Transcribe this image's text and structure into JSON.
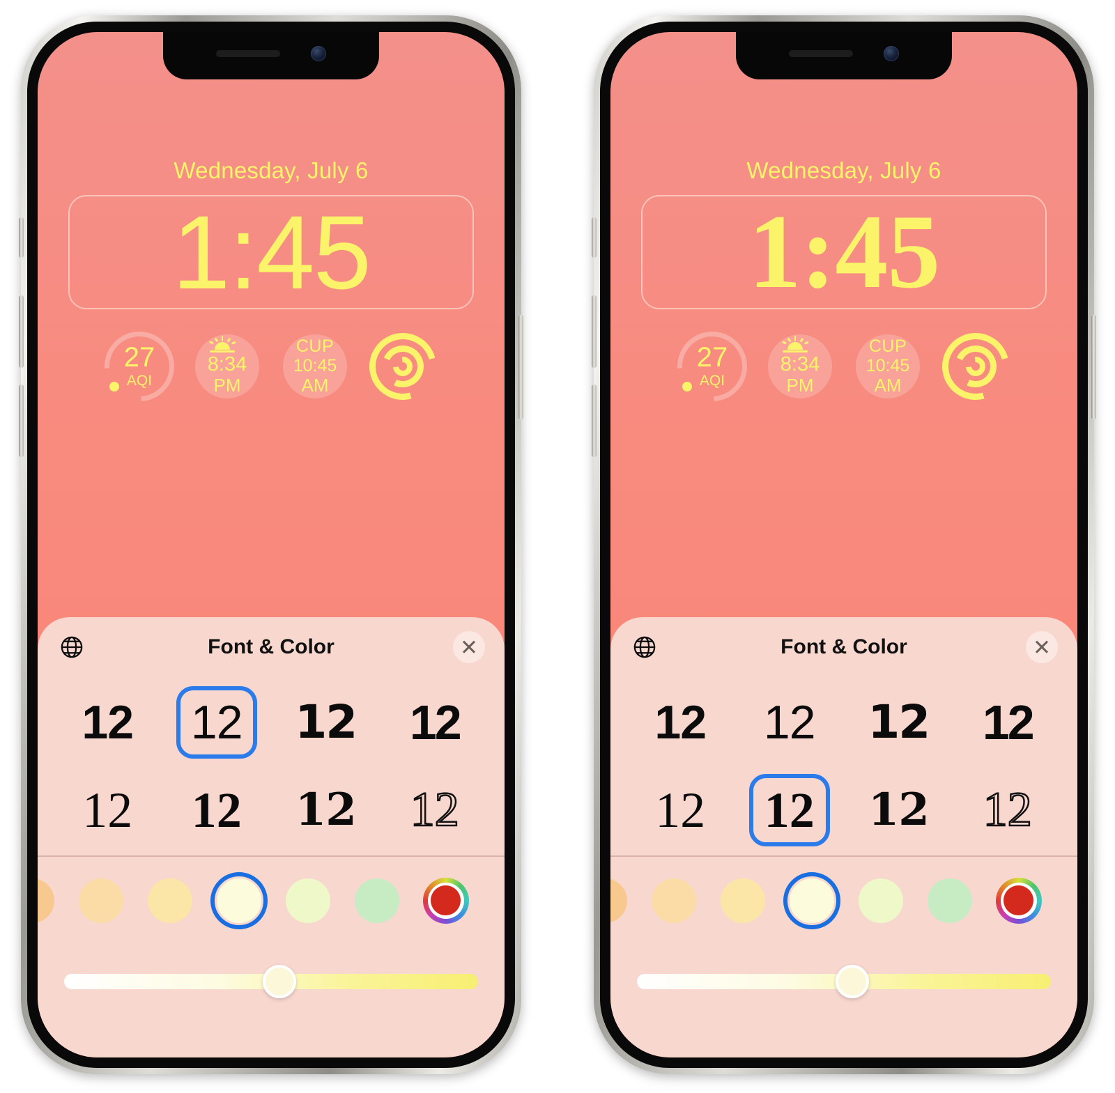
{
  "screenshot": {
    "description": "Two iPhone lock screen customization screens side by side showing Font & Color picker"
  },
  "lockscreen": {
    "date": "Wednesday, July 6",
    "time": "1:45",
    "widgets": [
      {
        "name": "air-quality",
        "value": "27",
        "label": "AQI",
        "icon": "gauge-arc-icon"
      },
      {
        "name": "sunset",
        "time": "8:34",
        "period": "PM",
        "icon": "sunset-icon"
      },
      {
        "name": "world-clock",
        "city": "CUP",
        "time": "10:45",
        "period": "AM",
        "icon": "clock-icon"
      },
      {
        "name": "activity-rings",
        "icon": "activity-rings-icon"
      }
    ]
  },
  "sheet": {
    "title": "Font & Color",
    "globe_icon": "globe-icon",
    "close_icon": "close-icon",
    "font_options": [
      {
        "id": "sans-bold",
        "sample": "12",
        "style": "f-sans-bold"
      },
      {
        "id": "sans-thin",
        "sample": "12",
        "style": "f-sans-thin"
      },
      {
        "id": "sans-round",
        "sample": "12",
        "style": "f-sans-round"
      },
      {
        "id": "sans-cond",
        "sample": "12",
        "style": "f-sans-cond"
      },
      {
        "id": "serif-thin",
        "sample": "12",
        "style": "f-serif-thin"
      },
      {
        "id": "serif-bold",
        "sample": "12",
        "style": "f-serif-bold"
      },
      {
        "id": "slab",
        "sample": "12",
        "style": "f-slab"
      },
      {
        "id": "outline",
        "sample": "12",
        "style": "f-outline"
      }
    ],
    "color_swatches": [
      {
        "id": "orange-clipped",
        "hex": "#f7c98e"
      },
      {
        "id": "peach",
        "hex": "#fbdca6"
      },
      {
        "id": "light-yellow",
        "hex": "#fbe6a8"
      },
      {
        "id": "pale-yellow",
        "hex": "#fcfbdc"
      },
      {
        "id": "lime-tint",
        "hex": "#eef8c8"
      },
      {
        "id": "mint-green",
        "hex": "#c7ecc4"
      },
      {
        "id": "color-wheel",
        "hex": "#d42a1e"
      }
    ],
    "selected_color_index": 3,
    "slider": {
      "name": "color-intensity-slider",
      "value_percent": 52
    }
  },
  "phones": {
    "left": {
      "selected_font_index": 1,
      "clock_class": "thin"
    },
    "right": {
      "selected_font_index": 5,
      "clock_class": "bold-serif"
    }
  },
  "colors": {
    "wallpaper_top": "#f3908a",
    "wallpaper_bottom": "#fb8a7b",
    "clock_yellow": "#fbf36a",
    "sheet_bg": "#f8d7cf",
    "selection_blue": "#2b7bea"
  }
}
